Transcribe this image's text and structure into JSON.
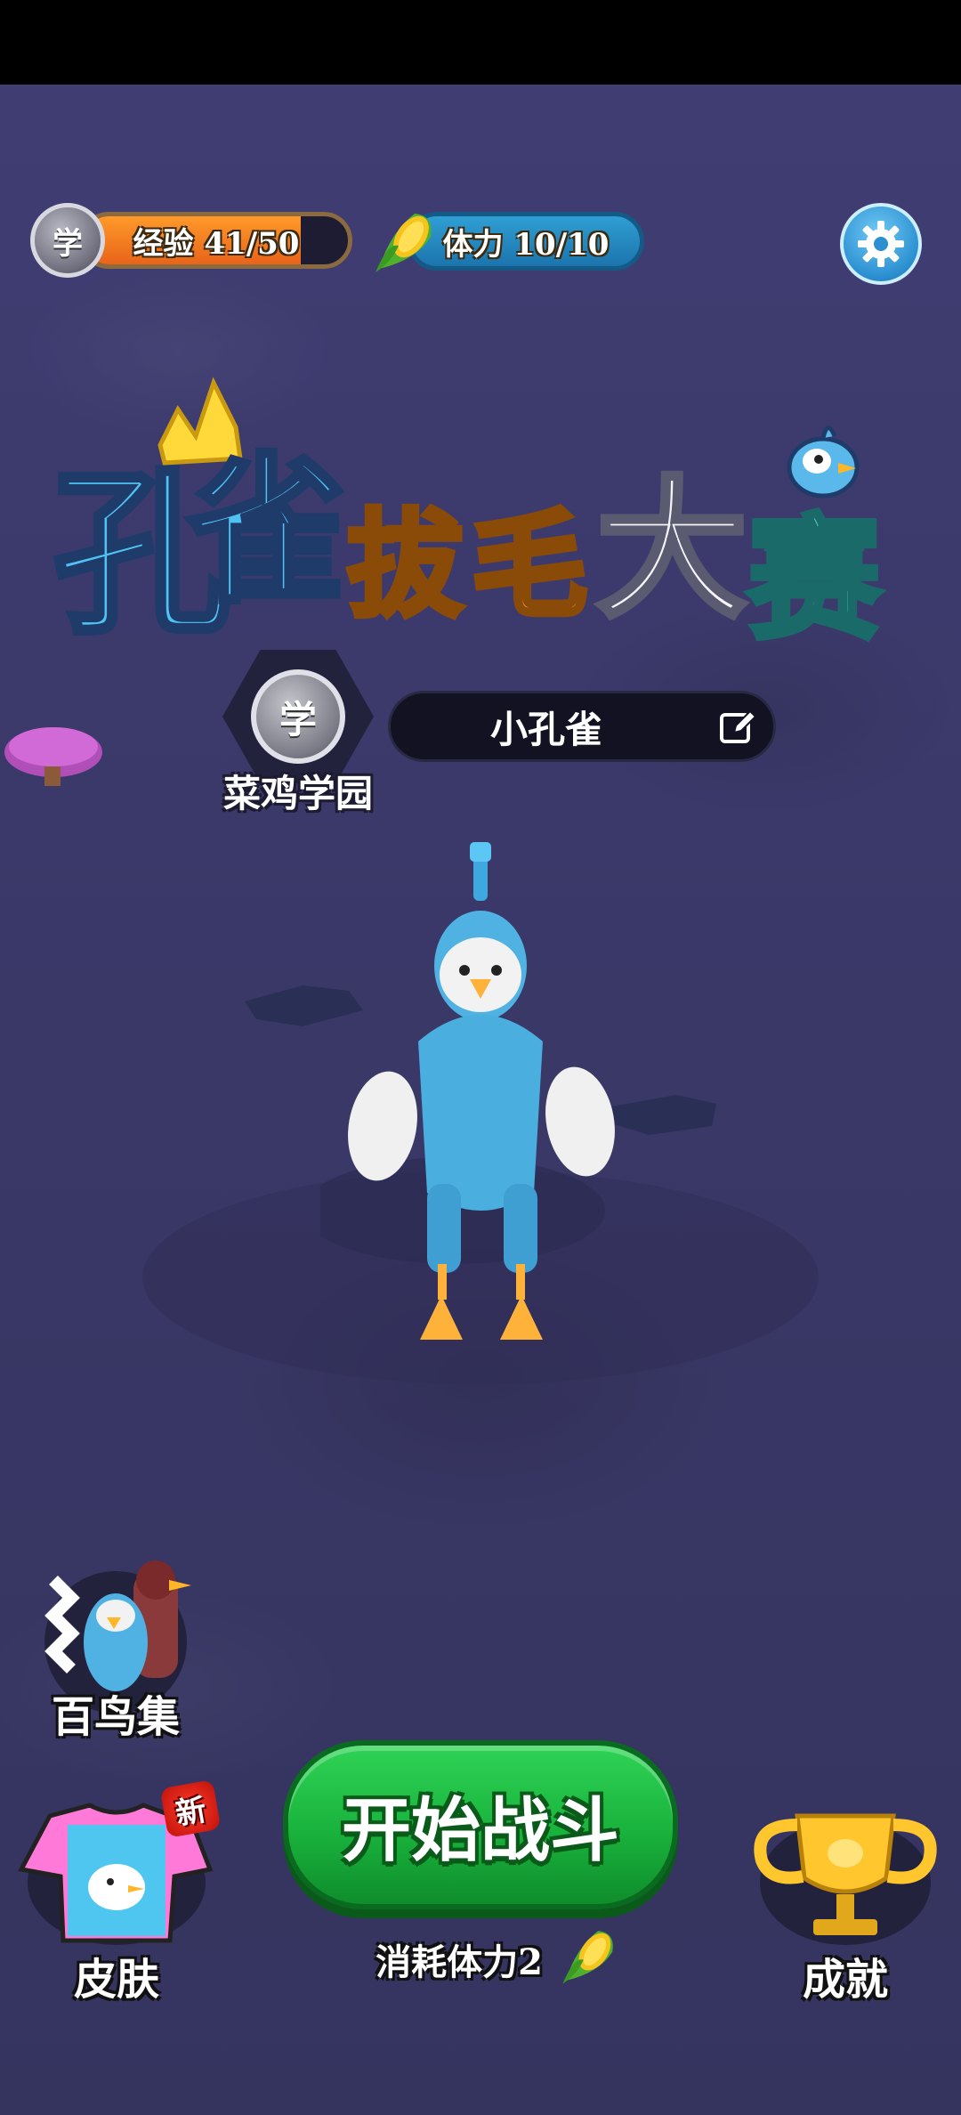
{
  "hud": {
    "rank_badge_char": "学",
    "exp_label": "经验 41/50",
    "exp_progress": 0.82,
    "stamina_label": "体力 10/10",
    "stamina_progress": 1.0,
    "settings_icon": "gear-icon"
  },
  "title": {
    "chars": [
      "孔",
      "雀",
      "拔",
      "毛",
      "大",
      "赛"
    ]
  },
  "player": {
    "rank_char": "学",
    "rank_name": "菜鸡学园",
    "nickname": "小孔雀",
    "edit_icon": "edit-icon"
  },
  "bottom": {
    "collection_label": "百鸟集",
    "skin_label": "皮肤",
    "skin_badge": "新",
    "start_label": "开始战斗",
    "cost_label": "消耗体力2",
    "achievement_label": "成就"
  },
  "colors": {
    "bg": "#3b3a6b",
    "start_green": "#19b23c",
    "exp_orange": "#e8641a",
    "stamina_blue": "#2f9fd3"
  }
}
